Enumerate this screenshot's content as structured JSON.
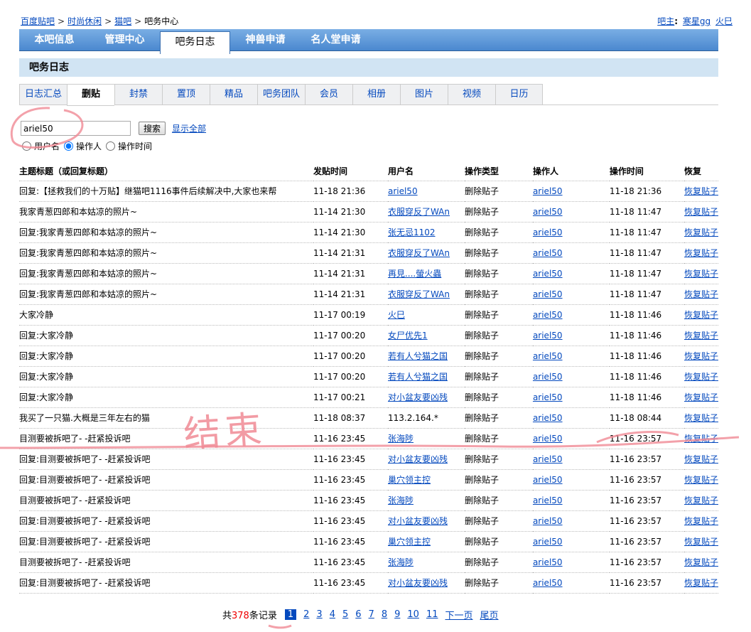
{
  "breadcrumb": [
    "百度贴吧",
    "时尚休闲",
    "猫吧",
    "吧务中心"
  ],
  "owner": {
    "label": "吧主",
    "names": [
      "寒星gg",
      "火巳"
    ]
  },
  "nav": [
    "本吧信息",
    "管理中心",
    "吧务日志",
    "神兽申请",
    "名人堂申请"
  ],
  "nav_active": 2,
  "section_title": "吧务日志",
  "subtabs": [
    "日志汇总",
    "删贴",
    "封禁",
    "置顶",
    "精品",
    "吧务团队",
    "会员",
    "相册",
    "图片",
    "视频",
    "日历"
  ],
  "subtab_active": 1,
  "search": {
    "value": "ariel50",
    "button": "搜索",
    "show_all": "显示全部",
    "options": [
      "用户名",
      "操作人",
      "操作时间"
    ],
    "selected": 1
  },
  "table": {
    "headers": [
      "主题标题（或回复标题）",
      "发贴时间",
      "用户名",
      "操作类型",
      "操作人",
      "操作时间",
      "恢复"
    ],
    "rows": [
      [
        "回复:【拯救我们的十万贴】继猫吧1116事件后续解决中,大家也来帮",
        "11-18 21:36",
        "ariel50",
        "删除贴子",
        "ariel50",
        "11-18 21:36",
        "恢复贴子"
      ],
      [
        "我家青葱四郎和本姑凉的照片~",
        "11-14 21:30",
        "衣服穿反了WAn",
        "删除贴子",
        "ariel50",
        "11-18 11:47",
        "恢复贴子"
      ],
      [
        "回复:我家青葱四郎和本姑凉的照片~",
        "11-14 21:30",
        "张无忌1102",
        "删除贴子",
        "ariel50",
        "11-18 11:47",
        "恢复贴子"
      ],
      [
        "回复:我家青葱四郎和本姑凉的照片~",
        "11-14 21:31",
        "衣服穿反了WAn",
        "删除贴子",
        "ariel50",
        "11-18 11:47",
        "恢复贴子"
      ],
      [
        "回复:我家青葱四郎和本姑凉的照片~",
        "11-14 21:31",
        "再見....螢火蟲",
        "删除贴子",
        "ariel50",
        "11-18 11:47",
        "恢复贴子"
      ],
      [
        "回复:我家青葱四郎和本姑凉的照片~",
        "11-14 21:31",
        "衣服穿反了WAn",
        "删除贴子",
        "ariel50",
        "11-18 11:47",
        "恢复贴子"
      ],
      [
        "大家冷静",
        "11-17 00:19",
        "火巳",
        "删除贴子",
        "ariel50",
        "11-18 11:46",
        "恢复贴子"
      ],
      [
        "回复:大家冷静",
        "11-17 00:20",
        "女尸优先1",
        "删除贴子",
        "ariel50",
        "11-18 11:46",
        "恢复贴子"
      ],
      [
        "回复:大家冷静",
        "11-17 00:20",
        "若有人兮猫之国",
        "删除贴子",
        "ariel50",
        "11-18 11:46",
        "恢复贴子"
      ],
      [
        "回复:大家冷静",
        "11-17 00:20",
        "若有人兮猫之国",
        "删除贴子",
        "ariel50",
        "11-18 11:46",
        "恢复贴子"
      ],
      [
        "回复:大家冷静",
        "11-17 00:21",
        "对小盆友要凶残",
        "删除贴子",
        "ariel50",
        "11-18 11:46",
        "恢复贴子"
      ],
      [
        "我买了一只猫.大概是三年左右的猫",
        "11-18 08:37",
        "113.2.164.*",
        "删除贴子",
        "ariel50",
        "11-18 08:44",
        "恢复贴子"
      ],
      [
        "目测要被拆吧了- -赶紧投诉吧",
        "11-16 23:45",
        "张海陟",
        "删除贴子",
        "ariel50",
        "11-16 23:57",
        "恢复贴子"
      ],
      [
        "回复:目测要被拆吧了- -赶紧投诉吧",
        "11-16 23:45",
        "对小盆友要凶残",
        "删除贴子",
        "ariel50",
        "11-16 23:57",
        "恢复贴子"
      ],
      [
        "回复:目测要被拆吧了- -赶紧投诉吧",
        "11-16 23:45",
        "巢穴领主控",
        "删除贴子",
        "ariel50",
        "11-16 23:57",
        "恢复贴子"
      ],
      [
        "目测要被拆吧了- -赶紧投诉吧",
        "11-16 23:45",
        "张海陟",
        "删除贴子",
        "ariel50",
        "11-16 23:57",
        "恢复贴子"
      ],
      [
        "回复:目测要被拆吧了- -赶紧投诉吧",
        "11-16 23:45",
        "对小盆友要凶残",
        "删除贴子",
        "ariel50",
        "11-16 23:57",
        "恢复贴子"
      ],
      [
        "回复:目测要被拆吧了- -赶紧投诉吧",
        "11-16 23:45",
        "巢穴领主控",
        "删除贴子",
        "ariel50",
        "11-16 23:57",
        "恢复贴子"
      ],
      [
        "目测要被拆吧了- -赶紧投诉吧",
        "11-16 23:45",
        "张海陟",
        "删除贴子",
        "ariel50",
        "11-16 23:57",
        "恢复贴子"
      ],
      [
        "回复:目测要被拆吧了- -赶紧投诉吧",
        "11-16 23:45",
        "对小盆友要凶残",
        "删除贴子",
        "ariel50",
        "11-16 23:57",
        "恢复贴子"
      ]
    ],
    "username_unlinked_rows": [
      11
    ]
  },
  "pager": {
    "prefix": "共",
    "total": "378",
    "suffix": "条记录",
    "current": "1",
    "pages": [
      "2",
      "3",
      "4",
      "5",
      "6",
      "7",
      "8",
      "9",
      "10",
      "11"
    ],
    "next": "下一页",
    "last": "尾页"
  },
  "annotation": {
    "handwritten": "结束",
    "color": "#f08a95"
  }
}
